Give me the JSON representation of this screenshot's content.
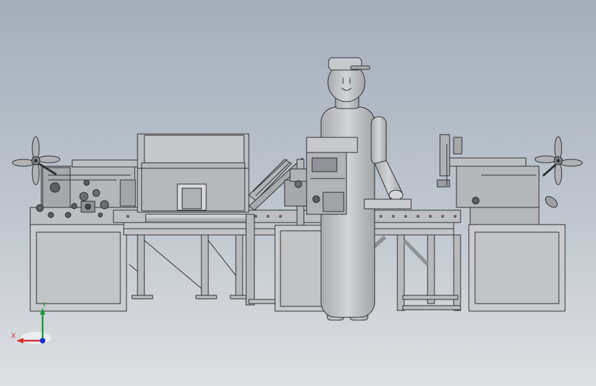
{
  "viewport": {
    "background_top": "#a4aebb",
    "background_bottom": "#dde0e3"
  },
  "model": {
    "line_color": "#2b2d30",
    "metal_fill": "#bdbfc2",
    "metal_dark": "#8e9196",
    "panel_fill": "#c9cbce",
    "robot_fill": "#c2c4c7"
  },
  "triad": {
    "x_label": "X",
    "y_label": "Y",
    "x_color": "#d63030",
    "y_color": "#1f9a3a",
    "z_color": "#1a2fd0"
  }
}
